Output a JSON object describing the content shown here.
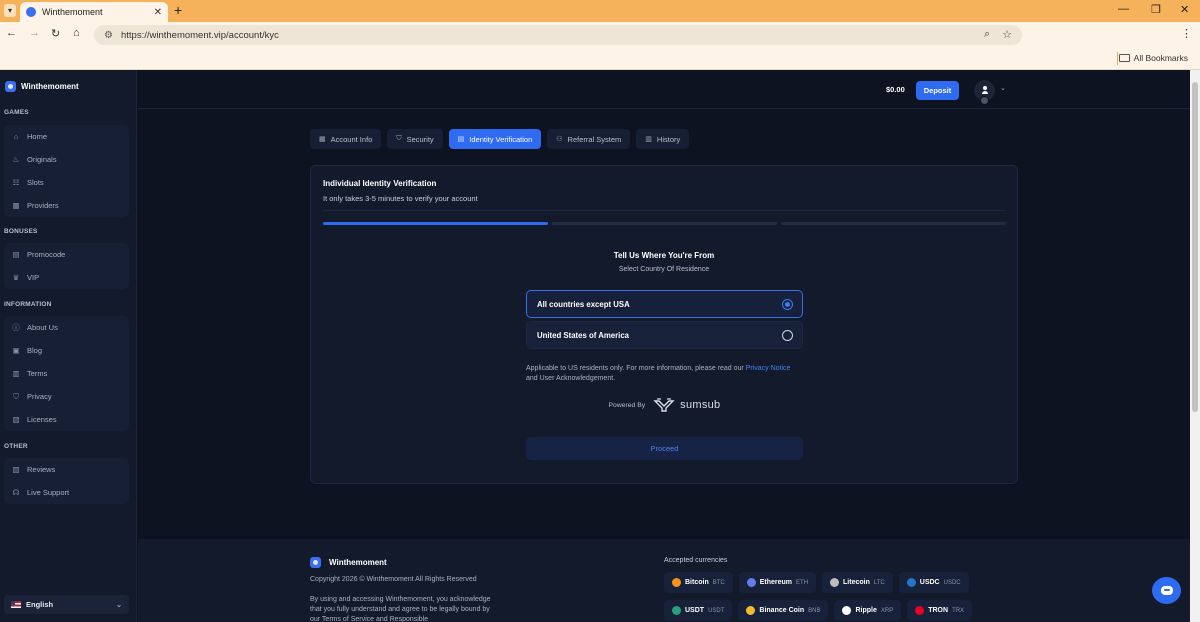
{
  "browser": {
    "tab_title": "Winthemoment",
    "url": "https://winthemoment.vip/account/kyc",
    "bookmarks_label": "All Bookmarks"
  },
  "sidebar": {
    "brand": "Winthemoment",
    "sections": {
      "games": "GAMES",
      "bonuses": "BONUSES",
      "information": "INFORMATION",
      "other": "OTHER"
    },
    "games": [
      {
        "label": "Home",
        "icon": "home-icon"
      },
      {
        "label": "Originals",
        "icon": "flame-icon"
      },
      {
        "label": "Slots",
        "icon": "slots-icon"
      },
      {
        "label": "Providers",
        "icon": "grid-icon"
      }
    ],
    "bonuses": [
      {
        "label": "Promocode",
        "icon": "ticket-icon"
      },
      {
        "label": "VIP",
        "icon": "crown-icon"
      }
    ],
    "information": [
      {
        "label": "About Us",
        "icon": "info-icon"
      },
      {
        "label": "Blog",
        "icon": "blog-icon"
      },
      {
        "label": "Terms",
        "icon": "document-icon"
      },
      {
        "label": "Privacy",
        "icon": "shield-icon"
      },
      {
        "label": "Licenses",
        "icon": "license-icon"
      }
    ],
    "other": [
      {
        "label": "Reviews",
        "icon": "reviews-icon"
      },
      {
        "label": "Live Support",
        "icon": "headset-icon"
      }
    ],
    "language": "English"
  },
  "header": {
    "balance": "$0.00",
    "deposit_label": "Deposit"
  },
  "account_tabs": [
    {
      "label": "Account Info",
      "icon": "grid-icon",
      "active": false
    },
    {
      "label": "Security",
      "icon": "shield-icon",
      "active": false
    },
    {
      "label": "Identity Verification",
      "icon": "id-card-icon",
      "active": true
    },
    {
      "label": "Referral System",
      "icon": "users-icon",
      "active": false
    },
    {
      "label": "History",
      "icon": "history-icon",
      "active": false
    }
  ],
  "kyc": {
    "title": "Individual Identity Verification",
    "subtitle": "It only takes 3-5 minutes to verify your account",
    "step": 1,
    "total_steps": 3,
    "question_title": "Tell Us Where You're From",
    "question_sub": "Select Country Of Residence",
    "options": [
      {
        "label": "All countries except USA",
        "selected": true
      },
      {
        "label": "United States of America",
        "selected": false
      }
    ],
    "note_prefix": "Applicable to US residents only. For more information, please read our ",
    "note_link": "Privacy Notice",
    "note_suffix": " and User Acknowledgement.",
    "powered_by": "Powered By",
    "provider": "sumsub",
    "proceed_label": "Proceed"
  },
  "footer": {
    "brand": "Winthemoment",
    "copyright": "Copyright 2026 © Winthemoment All Rights Reserved",
    "terms_text": "By using and accessing Winthemoment, you acknowledge that you fully understand and agree to be legally bound by our Terms of Service and Responsible",
    "currencies_title": "Accepted currencies",
    "currencies_row1": [
      {
        "name": "Bitcoin",
        "symbol": "BTC",
        "color": "#f7931a"
      },
      {
        "name": "Ethereum",
        "symbol": "ETH",
        "color": "#627eea"
      },
      {
        "name": "Litecoin",
        "symbol": "LTC",
        "color": "#bfbbbb"
      },
      {
        "name": "USDC",
        "symbol": "USDC",
        "color": "#2775ca"
      }
    ],
    "currencies_row2": [
      {
        "name": "USDT",
        "symbol": "USDT",
        "color": "#26a17b"
      },
      {
        "name": "Binance Coin",
        "symbol": "BNB",
        "color": "#f3ba2f"
      },
      {
        "name": "Ripple",
        "symbol": "XRP",
        "color": "#ffffff"
      },
      {
        "name": "TRON",
        "symbol": "TRX",
        "color": "#eb0029"
      }
    ]
  },
  "colors": {
    "accent": "#2e6bf0",
    "background": "#0e1321",
    "sidebar": "#121a2b"
  }
}
